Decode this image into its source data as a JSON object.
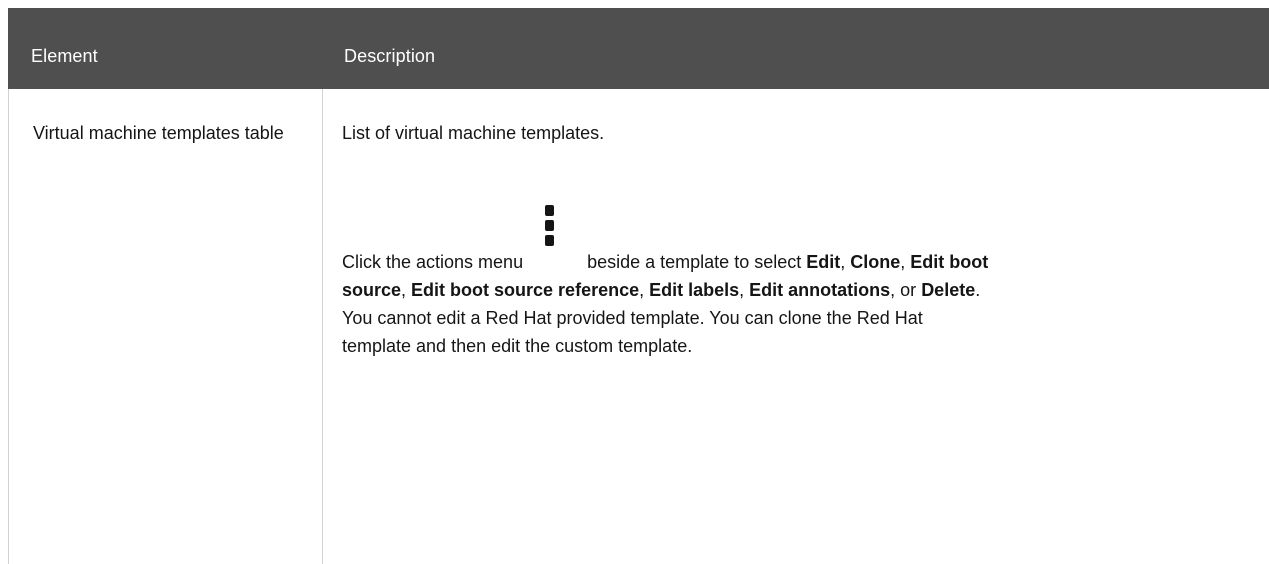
{
  "table": {
    "headers": {
      "element": "Element",
      "description": "Description"
    },
    "row": {
      "element": "Virtual machine templates table",
      "description_intro": "List of virtual machine templates.",
      "click_text": "Click the actions menu",
      "beside_text": "beside a template to select",
      "actions": {
        "edit": "Edit",
        "clone": "Clone",
        "edit_boot": "Edit boot",
        "source": "source",
        "edit_boot_source_reference": "Edit boot source reference",
        "edit_labels": "Edit labels",
        "edit_annotations": "Edit annotations",
        "delete": "Delete"
      },
      "note_line1": "You cannot edit a Red Hat provided template. You can clone the Red Hat",
      "note_line2": "template and then edit the custom template."
    },
    "icon": "kebab-icon",
    "header_color": "#4f4f4f",
    "divider_color": "#d2d2d2"
  }
}
